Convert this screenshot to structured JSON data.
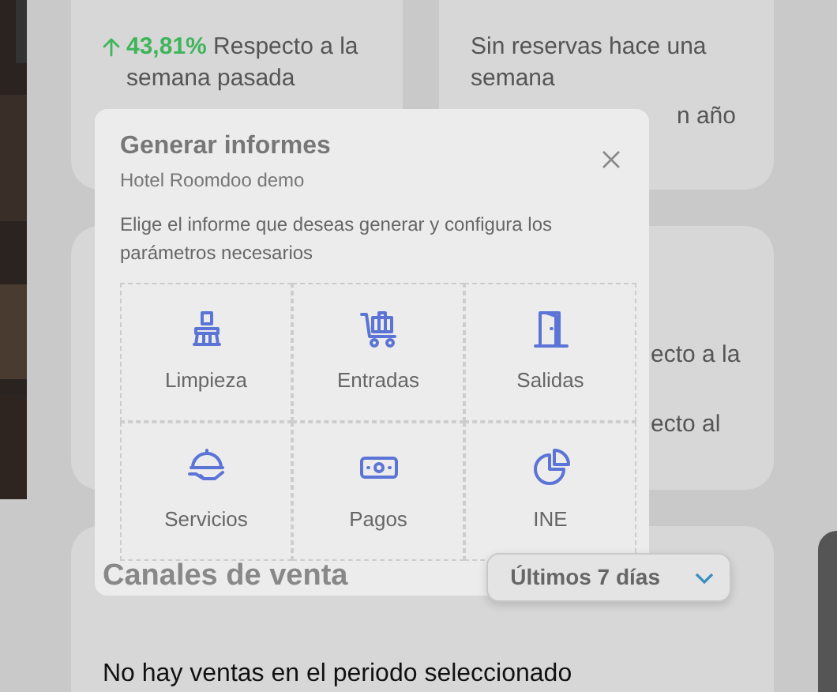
{
  "week_card": {
    "change": {
      "rising": true,
      "percent": "43,81%",
      "text": "Respecto a la semana pasada"
    }
  },
  "bookings_card": {
    "notes": [
      "Sin reservas hace una semana",
      "n año"
    ]
  },
  "revpar_card": {
    "fragments": [
      "ecto a la",
      "ecto al"
    ]
  },
  "sales": {
    "title": "Canales de venta",
    "period": "Últimos 7 días",
    "empty": "No hay ventas en el periodo seleccionado"
  },
  "modal": {
    "title": "Generar informes",
    "subtitle": "Hotel Roomdoo demo",
    "description": "Elige el informe que deseas generar y configura los parámetros necesarios",
    "reports": [
      {
        "label": "Limpieza",
        "kind": "broom"
      },
      {
        "label": "Entradas",
        "kind": "cart"
      },
      {
        "label": "Salidas",
        "kind": "door"
      },
      {
        "label": "Servicios",
        "kind": "cloche"
      },
      {
        "label": "Pagos",
        "kind": "money"
      },
      {
        "label": "INE",
        "kind": "pie"
      }
    ]
  }
}
